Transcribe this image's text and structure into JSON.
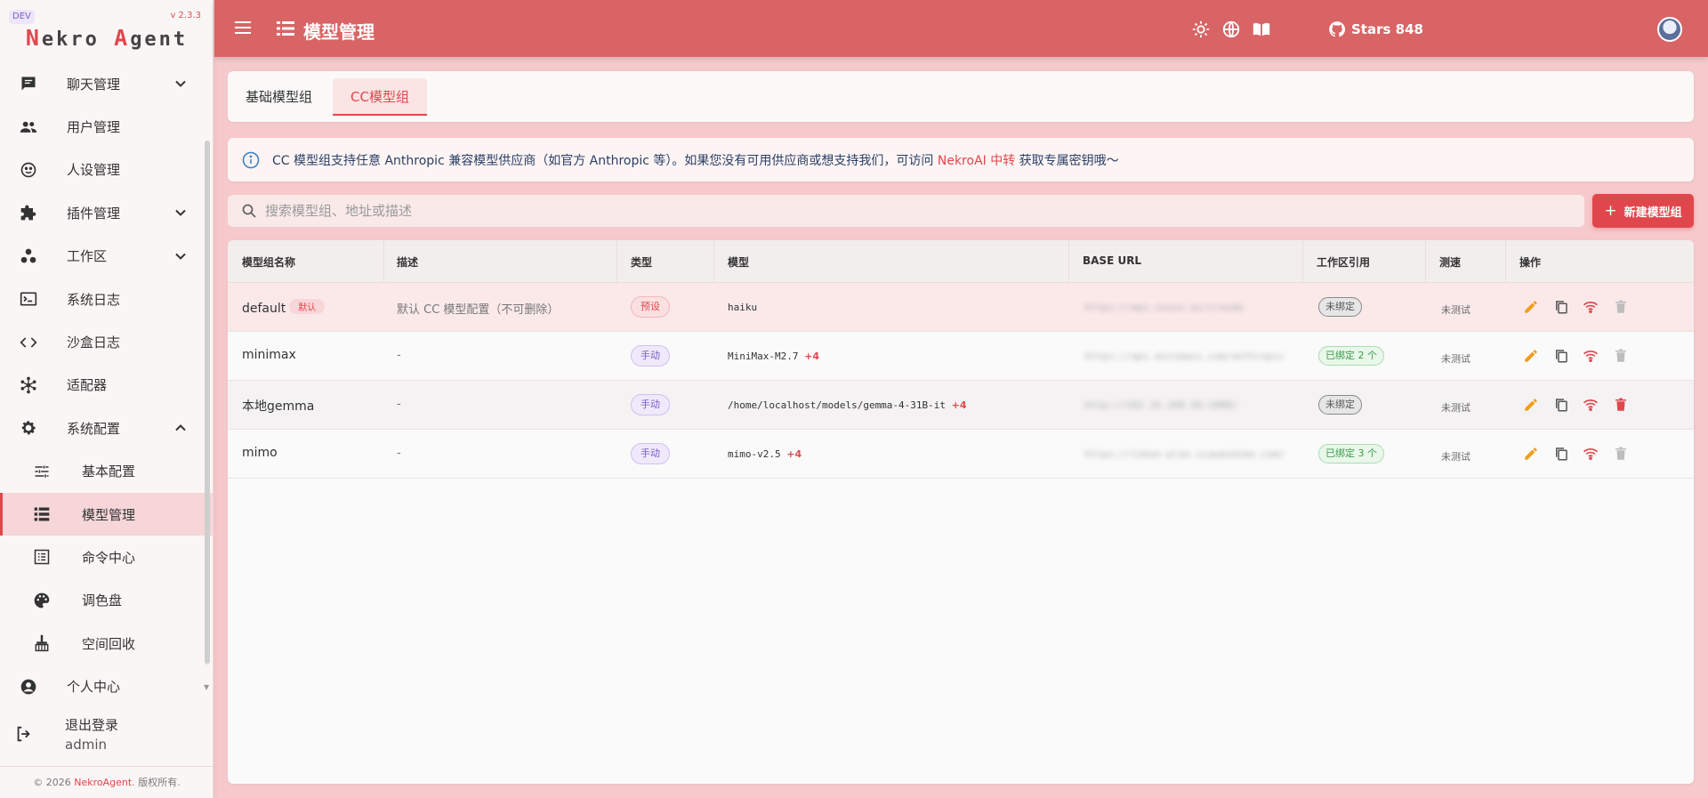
{
  "app": {
    "dev_badge": "DEV",
    "version": "v 2.3.3",
    "brand_n": "N",
    "brand_ekro": "ekro ",
    "brand_a": "A",
    "brand_gent": "gent"
  },
  "sidebar": {
    "items": [
      {
        "label": "聊天管理",
        "icon": "chat-icon",
        "expandable": true
      },
      {
        "label": "用户管理",
        "icon": "users-icon"
      },
      {
        "label": "人设管理",
        "icon": "persona-icon"
      },
      {
        "label": "插件管理",
        "icon": "puzzle-icon",
        "expandable": true
      },
      {
        "label": "工作区",
        "icon": "workspace-icon",
        "expandable": true
      },
      {
        "label": "系统日志",
        "icon": "terminal-icon"
      },
      {
        "label": "沙盒日志",
        "icon": "code-icon"
      },
      {
        "label": "适配器",
        "icon": "hub-icon"
      },
      {
        "label": "系统配置",
        "icon": "gear-icon",
        "expanded": true
      },
      {
        "label": "基本配置",
        "icon": "tune-icon",
        "sub": true
      },
      {
        "label": "模型管理",
        "icon": "list-icon",
        "sub": true,
        "active": true
      },
      {
        "label": "命令中心",
        "icon": "command-list-icon",
        "sub": true
      },
      {
        "label": "调色盘",
        "icon": "palette-icon",
        "sub": true
      },
      {
        "label": "空间回收",
        "icon": "broom-icon",
        "sub": true
      },
      {
        "label": "个人中心",
        "icon": "account-icon"
      }
    ],
    "logout_label": "退出登录",
    "logout_user": "admin",
    "footer_prefix": "© 2026 ",
    "footer_link": "NekroAgent",
    "footer_suffix": ". 版权所有."
  },
  "topbar": {
    "title": "模型管理",
    "stars": "Stars 848"
  },
  "tabs": [
    {
      "label": "基础模型组",
      "active": false
    },
    {
      "label": "CC模型组",
      "active": true
    }
  ],
  "info": {
    "text_before": "CC 模型组支持任意 Anthropic 兼容模型供应商（如官方 Anthropic 等）。如果您没有可用供应商或想支持我们，可访问 ",
    "link": "NekroAI 中转",
    "text_after": " 获取专属密钥哦～"
  },
  "search": {
    "placeholder": "搜索模型组、地址或描述",
    "value": ""
  },
  "new_button": "新建模型组",
  "table": {
    "headers": [
      "模型组名称",
      "描述",
      "类型",
      "模型",
      "BASE URL",
      "工作区引用",
      "测速",
      "操作"
    ],
    "rows": [
      {
        "name": "default",
        "default_badge": "默认",
        "desc": "默认 CC 模型配置（不可删除）",
        "type": "预设",
        "type_kind": "preset",
        "model": "haiku",
        "more": "",
        "url": "https://api.xxxxx.ai/claude",
        "ref": "未绑定",
        "ref_kind": "unbound",
        "speed": "未测试",
        "deletable": false
      },
      {
        "name": "minimax",
        "default_badge": "",
        "desc": "-",
        "type": "手动",
        "type_kind": "manual",
        "model": "MiniMax-M2.7",
        "more": "+4",
        "url": "https://api.minimaxi.com/anthropic",
        "ref": "已绑定 2 个",
        "ref_kind": "bound",
        "speed": "未测试",
        "deletable": false
      },
      {
        "name": "本地gemma",
        "default_badge": "",
        "desc": "-",
        "type": "手动",
        "type_kind": "manual",
        "model": "/home/localhost/models/gemma-4-31B-it",
        "more": "+4",
        "url": "http://192.16.160.56:1000/",
        "ref": "未绑定",
        "ref_kind": "unbound",
        "speed": "未测试",
        "deletable": true
      },
      {
        "name": "mimo",
        "default_badge": "",
        "desc": "-",
        "type": "手动",
        "type_kind": "manual",
        "model": "mimo-v2.5",
        "more": "+4",
        "url": "https://token-plan.xiaomimimo.com/",
        "ref": "已绑定 3 个",
        "ref_kind": "bound",
        "speed": "未测试",
        "deletable": false
      }
    ]
  },
  "colors": {
    "accent": "#e0474c",
    "topbar": "#d96465",
    "bound": "#3a9b49",
    "manual": "#7a5cc4",
    "edit_icon": "#f29d1a"
  }
}
